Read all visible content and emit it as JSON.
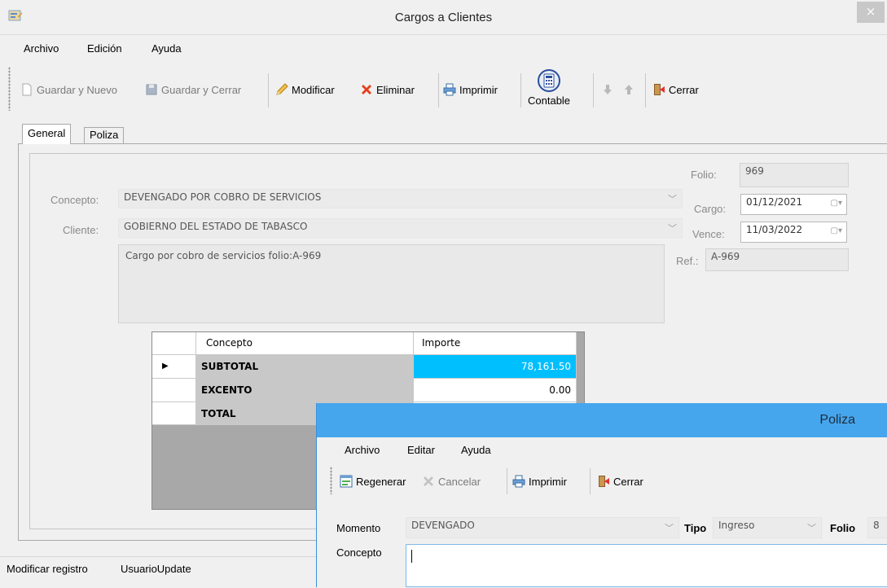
{
  "window": {
    "title": "Cargos a Clientes",
    "close": "×"
  },
  "menu": [
    "Archivo",
    "Edición",
    "Ayuda"
  ],
  "toolbar": {
    "guardar_nuevo": "Guardar y Nuevo",
    "guardar_cerrar": "Guardar y Cerrar",
    "modificar": "Modificar",
    "eliminar": "Eliminar",
    "imprimir": "Imprimir",
    "contable": "Contable",
    "cerrar": "Cerrar"
  },
  "tabs": [
    "General",
    "Poliza"
  ],
  "form": {
    "concepto_label": "Concepto:",
    "concepto_value": "DEVENGADO POR COBRO DE SERVICIOS",
    "cliente_label": "Cliente:",
    "cliente_value": "GOBIERNO DEL ESTADO DE TABASCO",
    "descripcion": "Cargo por cobro de servicios folio:A-969",
    "folio_label": "Folio:",
    "folio_value": "969",
    "cargo_label": "Cargo:",
    "cargo_value": "01/12/2021",
    "vence_label": "Vence:",
    "vence_value": "11/03/2022",
    "ref_label": "Ref.:",
    "ref_value": "A-969"
  },
  "grid": {
    "headers": [
      "Concepto",
      "Importe"
    ],
    "rows": [
      {
        "concepto": "SUBTOTAL",
        "importe": "78,161.50",
        "selected": true
      },
      {
        "concepto": "EXCENTO",
        "importe": "0.00"
      },
      {
        "concepto": "TOTAL",
        "importe": ""
      }
    ],
    "row_indicator": "▶"
  },
  "status": {
    "text": "Modificar registro",
    "user": "UsuarioUpdate"
  },
  "poliza": {
    "title": "Poliza",
    "menu": [
      "Archivo",
      "Editar",
      "Ayuda"
    ],
    "toolbar": {
      "regenerar": "Regenerar",
      "cancelar": "Cancelar",
      "imprimir": "Imprimir",
      "cerrar": "Cerrar"
    },
    "momento_label": "Momento",
    "momento_value": "DEVENGADO",
    "tipo_label": "Tipo",
    "tipo_value": "Ingreso",
    "folio_label": "Folio",
    "folio_value": "8",
    "concepto_label": "Concepto"
  },
  "colors": {
    "selected_cell": "#00bfff",
    "poliza_title": "#46a6ed",
    "delete_icon": "#e83c1e"
  }
}
